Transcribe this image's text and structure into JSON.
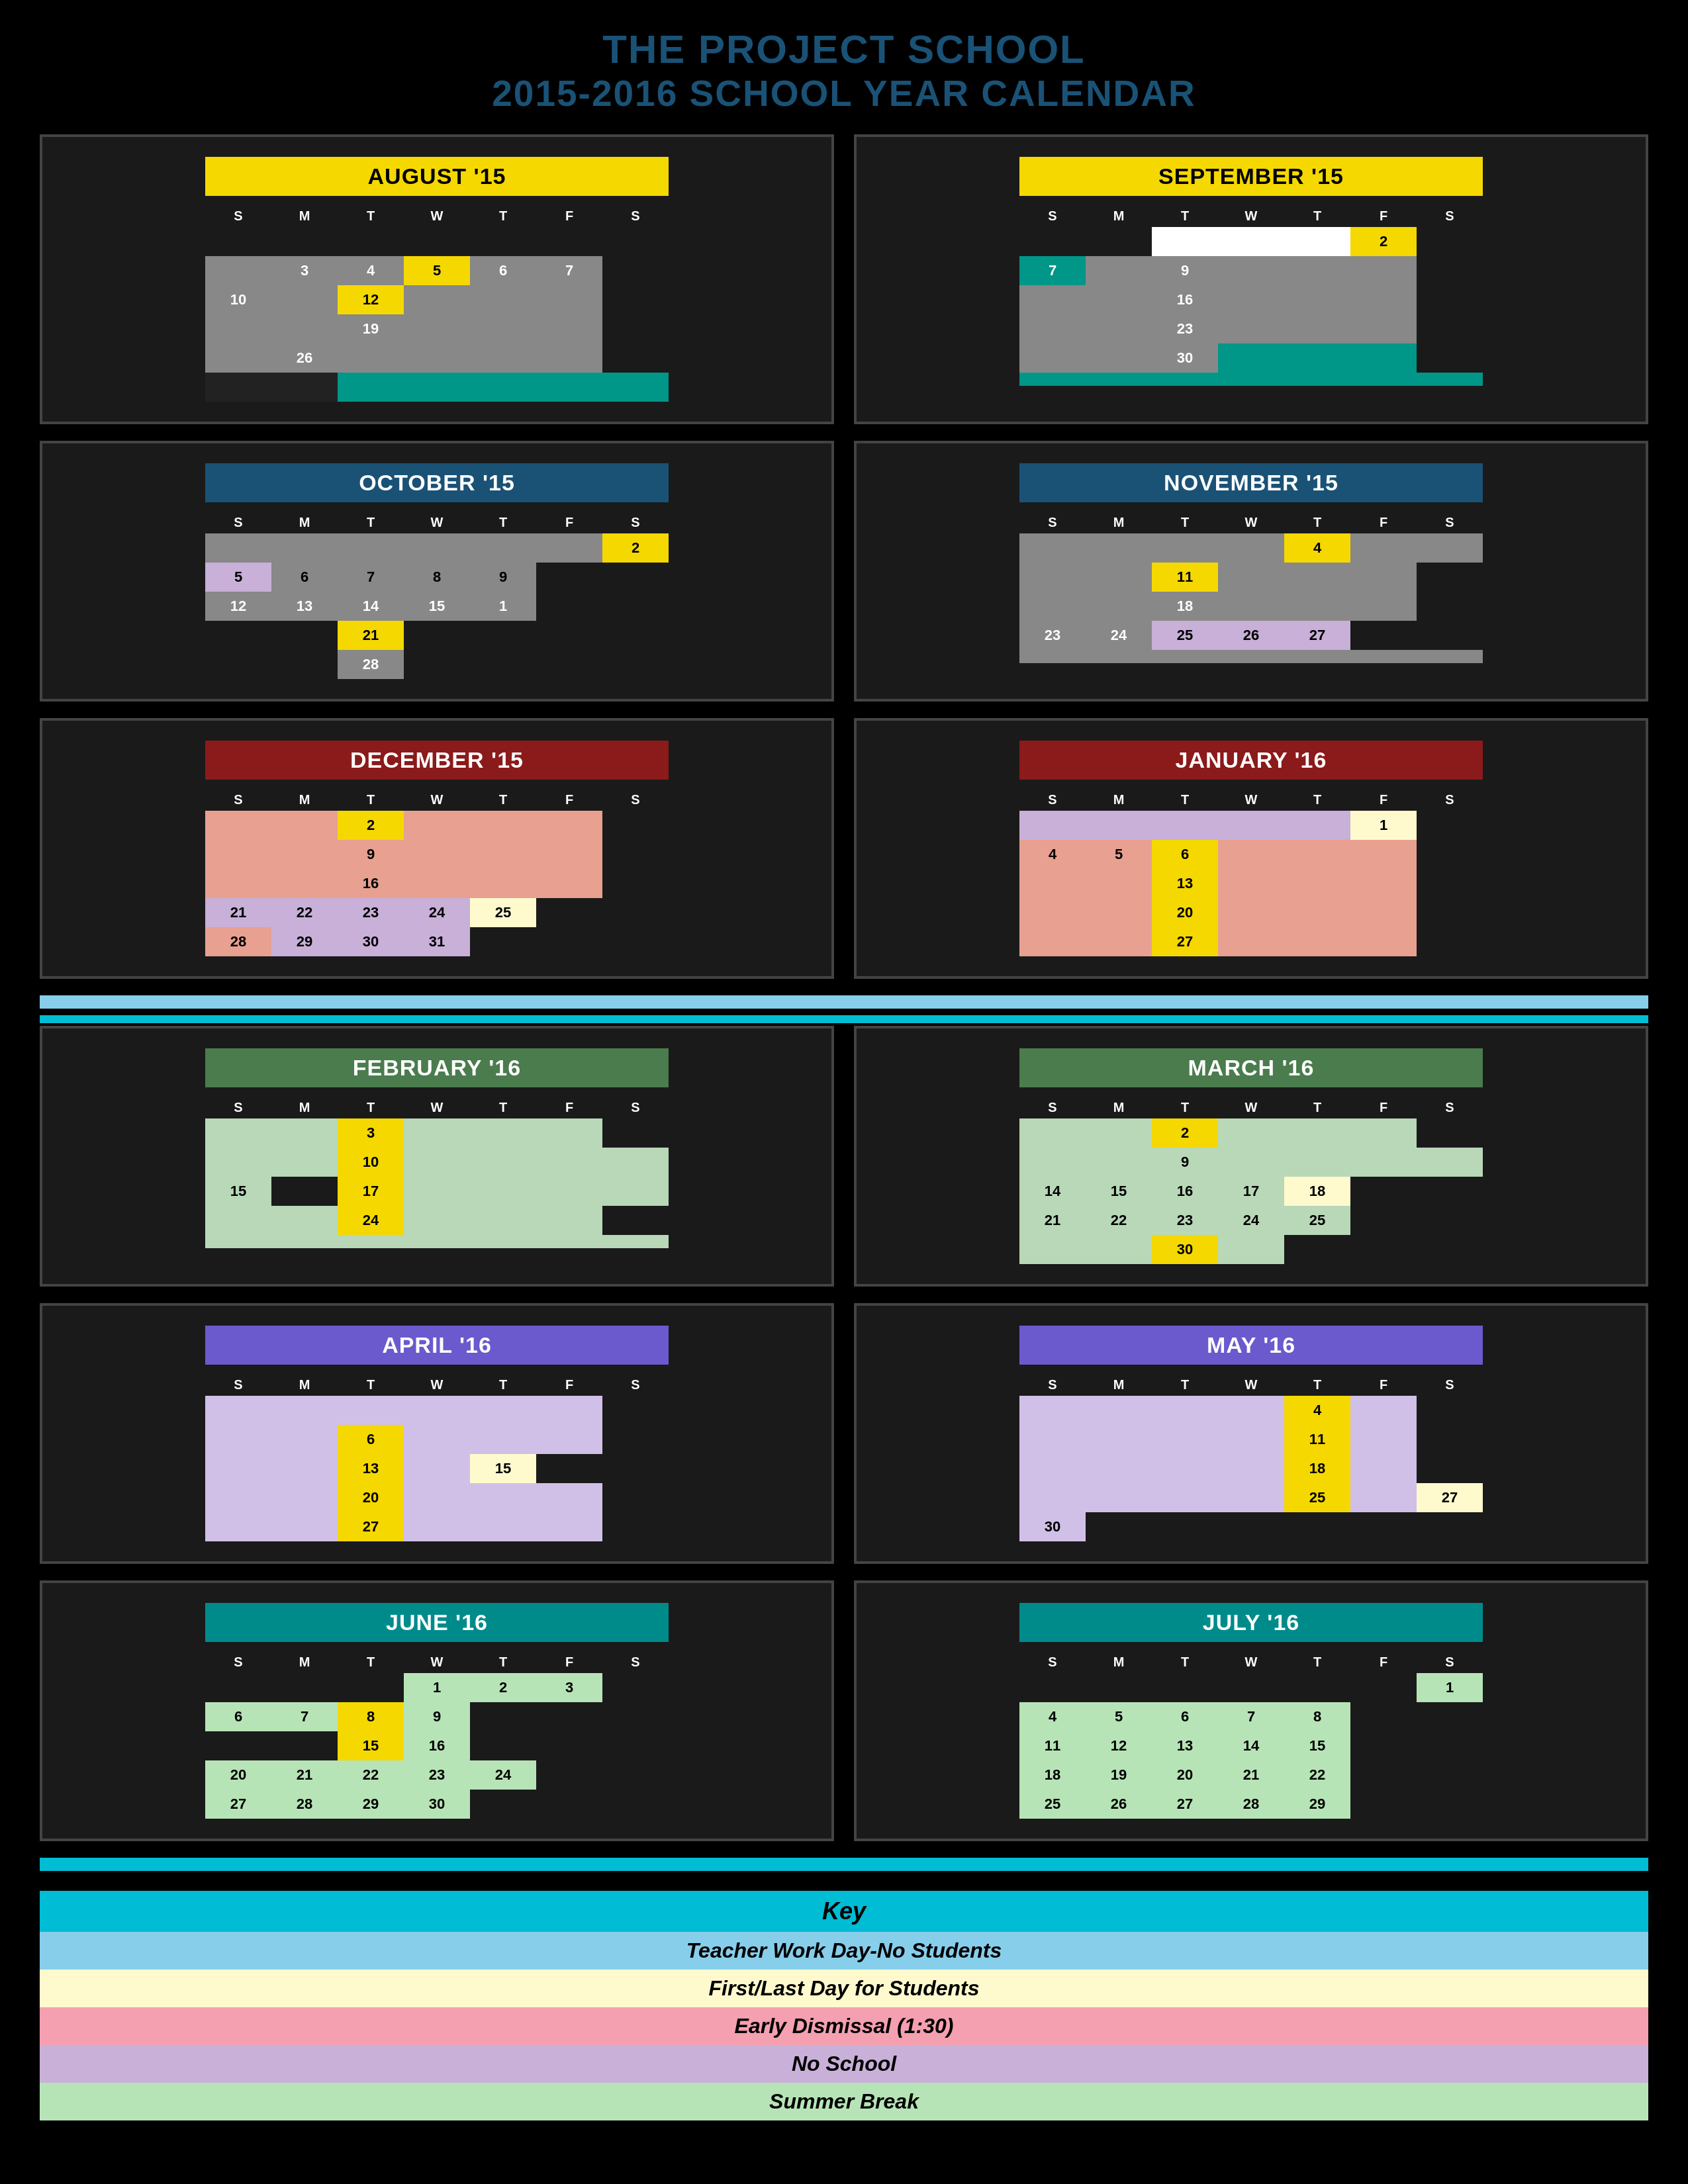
{
  "header": {
    "line1": "THE PROJECT SCHOOL",
    "line2": "2015-2016 SCHOOL YEAR CALENDAR"
  },
  "legend": {
    "key_label": "Key",
    "items": [
      {
        "label": "Teacher Work Day-No Students",
        "color": "#87ceeb"
      },
      {
        "label": "First/Last Day for Students",
        "color": "#fffacd"
      },
      {
        "label": "Early Dismissal (1:30)",
        "color": "#f4a0b0"
      },
      {
        "label": "No School",
        "color": "#c9b1d9"
      },
      {
        "label": "Summer Break",
        "color": "#b7e4b7"
      }
    ]
  },
  "weekdays": [
    "S",
    "M",
    "T",
    "W",
    "T",
    "F",
    "S"
  ]
}
